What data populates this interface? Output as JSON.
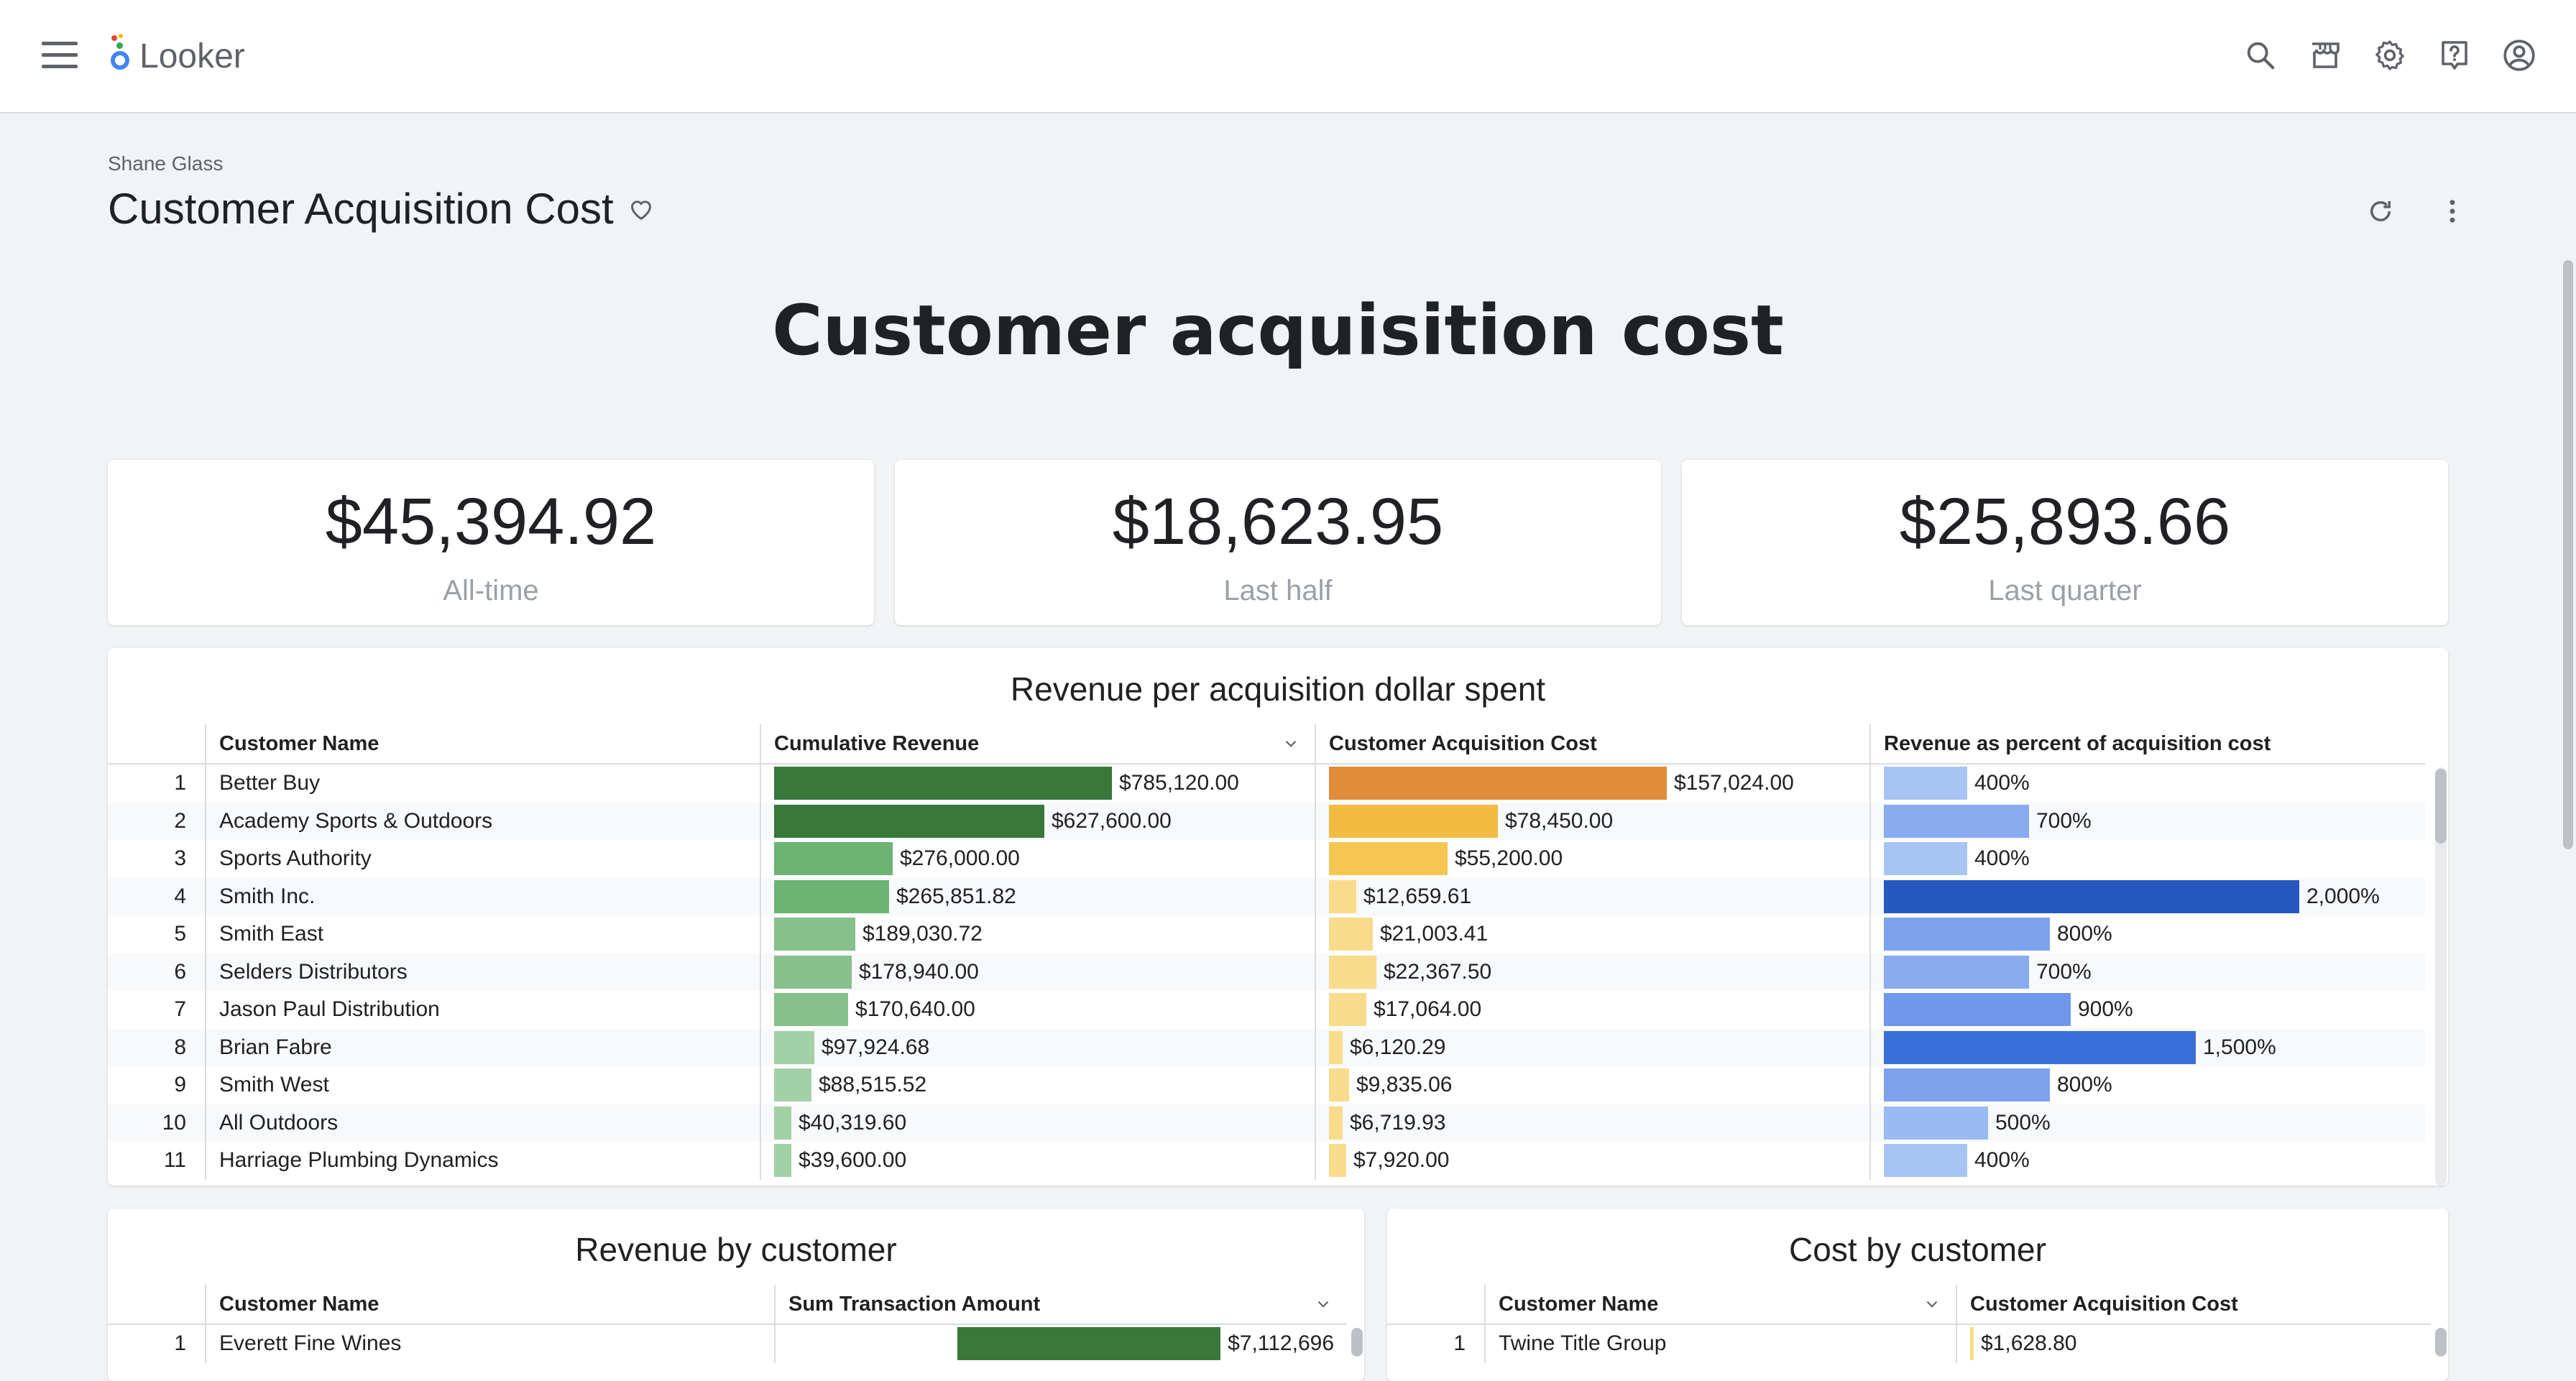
{
  "app": {
    "name": "Looker"
  },
  "header": {
    "owner": "Shane Glass",
    "title": "Customer Acquisition Cost",
    "icons": [
      "search-icon",
      "marketplace-icon",
      "settings-icon",
      "help-icon",
      "account-icon"
    ]
  },
  "dashboard": {
    "heading": "Customer acquisition cost",
    "kpis": [
      {
        "value": "$45,394.92",
        "label": "All-time"
      },
      {
        "value": "$18,623.95",
        "label": "Last half"
      },
      {
        "value": "$25,893.66",
        "label": "Last quarter"
      }
    ],
    "main_table": {
      "title": "Revenue per acquisition dollar spent",
      "columns": [
        "Customer Name",
        "Cumulative Revenue",
        "Customer Acquisition Cost",
        "Revenue as percent of acquisition cost"
      ],
      "rows": [
        {
          "n": "1",
          "name": "Better Buy",
          "rev": "$785,120.00",
          "rev_frac": 1.0,
          "rev_color": "#38783b",
          "cost": "$157,024.00",
          "cost_frac": 1.0,
          "cost_color": "#e08c38",
          "pct": "400%",
          "pct_frac": 0.2,
          "pct_color": "#a8c4f5"
        },
        {
          "n": "2",
          "name": "Academy Sports & Outdoors",
          "rev": "$627,600.00",
          "rev_frac": 0.8,
          "rev_color": "#38783b",
          "cost": "$78,450.00",
          "cost_frac": 0.5,
          "cost_color": "#f2bc41",
          "pct": "700%",
          "pct_frac": 0.35,
          "pct_color": "#8aaaf0"
        },
        {
          "n": "3",
          "name": "Sports Authority",
          "rev": "$276,000.00",
          "rev_frac": 0.35,
          "rev_color": "#6db373",
          "cost": "$55,200.00",
          "cost_frac": 0.35,
          "cost_color": "#f5c653",
          "pct": "400%",
          "pct_frac": 0.2,
          "pct_color": "#a8c4f5"
        },
        {
          "n": "4",
          "name": "Smith Inc.",
          "rev": "$265,851.82",
          "rev_frac": 0.34,
          "rev_color": "#6db373",
          "cost": "$12,659.61",
          "cost_frac": 0.08,
          "cost_color": "#f8dc8c",
          "pct": "2,000%",
          "pct_frac": 1.0,
          "pct_color": "#2658bf"
        },
        {
          "n": "5",
          "name": "Smith East",
          "rev": "$189,030.72",
          "rev_frac": 0.24,
          "rev_color": "#86c08a",
          "cost": "$21,003.41",
          "cost_frac": 0.13,
          "cost_color": "#f8dc8c",
          "pct": "800%",
          "pct_frac": 0.4,
          "pct_color": "#7da2ee"
        },
        {
          "n": "6",
          "name": "Selders Distributors",
          "rev": "$178,940.00",
          "rev_frac": 0.23,
          "rev_color": "#86c08a",
          "cost": "$22,367.50",
          "cost_frac": 0.14,
          "cost_color": "#f8dc8c",
          "pct": "700%",
          "pct_frac": 0.35,
          "pct_color": "#8aaaf0"
        },
        {
          "n": "7",
          "name": "Jason Paul Distribution",
          "rev": "$170,640.00",
          "rev_frac": 0.22,
          "rev_color": "#86c08a",
          "cost": "$17,064.00",
          "cost_frac": 0.11,
          "cost_color": "#f8dc8c",
          "pct": "900%",
          "pct_frac": 0.45,
          "pct_color": "#6f97ec"
        },
        {
          "n": "8",
          "name": "Brian Fabre",
          "rev": "$97,924.68",
          "rev_frac": 0.12,
          "rev_color": "#a3d1a6",
          "cost": "$6,120.29",
          "cost_frac": 0.04,
          "cost_color": "#f8dc8c",
          "pct": "1,500%",
          "pct_frac": 0.75,
          "pct_color": "#3b6fd8"
        },
        {
          "n": "9",
          "name": "Smith West",
          "rev": "$88,515.52",
          "rev_frac": 0.11,
          "rev_color": "#a3d1a6",
          "cost": "$9,835.06",
          "cost_frac": 0.06,
          "cost_color": "#f8dc8c",
          "pct": "800%",
          "pct_frac": 0.4,
          "pct_color": "#7da2ee"
        },
        {
          "n": "10",
          "name": "All Outdoors",
          "rev": "$40,319.60",
          "rev_frac": 0.05,
          "rev_color": "#a3d1a6",
          "cost": "$6,719.93",
          "cost_frac": 0.04,
          "cost_color": "#f8dc8c",
          "pct": "500%",
          "pct_frac": 0.25,
          "pct_color": "#9bbaf3"
        },
        {
          "n": "11",
          "name": "Harriage Plumbing Dynamics",
          "rev": "$39,600.00",
          "rev_frac": 0.05,
          "rev_color": "#a3d1a6",
          "cost": "$7,920.00",
          "cost_frac": 0.05,
          "cost_color": "#f8dc8c",
          "pct": "400%",
          "pct_frac": 0.2,
          "pct_color": "#a8c4f5"
        }
      ]
    },
    "revenue_tile": {
      "title": "Revenue by customer",
      "columns": [
        "Customer Name",
        "Sum Transaction Amount"
      ],
      "rows": [
        {
          "n": "1",
          "name": "Everett Fine Wines",
          "value": "$7,112,696",
          "frac": 1.0,
          "color": "#38783b"
        }
      ]
    },
    "cost_tile": {
      "title": "Cost by customer",
      "columns": [
        "Customer Name",
        "Customer Acquisition Cost"
      ],
      "rows": [
        {
          "n": "1",
          "name": "Twine Title Group",
          "value": "$1,628.80",
          "frac": 0.01,
          "color": "#f8dc8c"
        }
      ]
    }
  }
}
